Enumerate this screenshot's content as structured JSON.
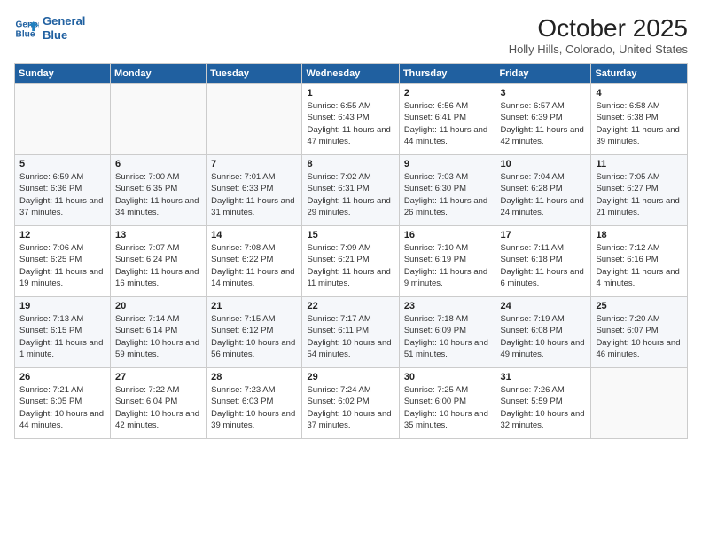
{
  "header": {
    "logo_line1": "General",
    "logo_line2": "Blue",
    "title": "October 2025",
    "subtitle": "Holly Hills, Colorado, United States"
  },
  "days_of_week": [
    "Sunday",
    "Monday",
    "Tuesday",
    "Wednesday",
    "Thursday",
    "Friday",
    "Saturday"
  ],
  "weeks": [
    [
      {
        "day": "",
        "info": ""
      },
      {
        "day": "",
        "info": ""
      },
      {
        "day": "",
        "info": ""
      },
      {
        "day": "1",
        "info": "Sunrise: 6:55 AM\nSunset: 6:43 PM\nDaylight: 11 hours and 47 minutes."
      },
      {
        "day": "2",
        "info": "Sunrise: 6:56 AM\nSunset: 6:41 PM\nDaylight: 11 hours and 44 minutes."
      },
      {
        "day": "3",
        "info": "Sunrise: 6:57 AM\nSunset: 6:39 PM\nDaylight: 11 hours and 42 minutes."
      },
      {
        "day": "4",
        "info": "Sunrise: 6:58 AM\nSunset: 6:38 PM\nDaylight: 11 hours and 39 minutes."
      }
    ],
    [
      {
        "day": "5",
        "info": "Sunrise: 6:59 AM\nSunset: 6:36 PM\nDaylight: 11 hours and 37 minutes."
      },
      {
        "day": "6",
        "info": "Sunrise: 7:00 AM\nSunset: 6:35 PM\nDaylight: 11 hours and 34 minutes."
      },
      {
        "day": "7",
        "info": "Sunrise: 7:01 AM\nSunset: 6:33 PM\nDaylight: 11 hours and 31 minutes."
      },
      {
        "day": "8",
        "info": "Sunrise: 7:02 AM\nSunset: 6:31 PM\nDaylight: 11 hours and 29 minutes."
      },
      {
        "day": "9",
        "info": "Sunrise: 7:03 AM\nSunset: 6:30 PM\nDaylight: 11 hours and 26 minutes."
      },
      {
        "day": "10",
        "info": "Sunrise: 7:04 AM\nSunset: 6:28 PM\nDaylight: 11 hours and 24 minutes."
      },
      {
        "day": "11",
        "info": "Sunrise: 7:05 AM\nSunset: 6:27 PM\nDaylight: 11 hours and 21 minutes."
      }
    ],
    [
      {
        "day": "12",
        "info": "Sunrise: 7:06 AM\nSunset: 6:25 PM\nDaylight: 11 hours and 19 minutes."
      },
      {
        "day": "13",
        "info": "Sunrise: 7:07 AM\nSunset: 6:24 PM\nDaylight: 11 hours and 16 minutes."
      },
      {
        "day": "14",
        "info": "Sunrise: 7:08 AM\nSunset: 6:22 PM\nDaylight: 11 hours and 14 minutes."
      },
      {
        "day": "15",
        "info": "Sunrise: 7:09 AM\nSunset: 6:21 PM\nDaylight: 11 hours and 11 minutes."
      },
      {
        "day": "16",
        "info": "Sunrise: 7:10 AM\nSunset: 6:19 PM\nDaylight: 11 hours and 9 minutes."
      },
      {
        "day": "17",
        "info": "Sunrise: 7:11 AM\nSunset: 6:18 PM\nDaylight: 11 hours and 6 minutes."
      },
      {
        "day": "18",
        "info": "Sunrise: 7:12 AM\nSunset: 6:16 PM\nDaylight: 11 hours and 4 minutes."
      }
    ],
    [
      {
        "day": "19",
        "info": "Sunrise: 7:13 AM\nSunset: 6:15 PM\nDaylight: 11 hours and 1 minute."
      },
      {
        "day": "20",
        "info": "Sunrise: 7:14 AM\nSunset: 6:14 PM\nDaylight: 10 hours and 59 minutes."
      },
      {
        "day": "21",
        "info": "Sunrise: 7:15 AM\nSunset: 6:12 PM\nDaylight: 10 hours and 56 minutes."
      },
      {
        "day": "22",
        "info": "Sunrise: 7:17 AM\nSunset: 6:11 PM\nDaylight: 10 hours and 54 minutes."
      },
      {
        "day": "23",
        "info": "Sunrise: 7:18 AM\nSunset: 6:09 PM\nDaylight: 10 hours and 51 minutes."
      },
      {
        "day": "24",
        "info": "Sunrise: 7:19 AM\nSunset: 6:08 PM\nDaylight: 10 hours and 49 minutes."
      },
      {
        "day": "25",
        "info": "Sunrise: 7:20 AM\nSunset: 6:07 PM\nDaylight: 10 hours and 46 minutes."
      }
    ],
    [
      {
        "day": "26",
        "info": "Sunrise: 7:21 AM\nSunset: 6:05 PM\nDaylight: 10 hours and 44 minutes."
      },
      {
        "day": "27",
        "info": "Sunrise: 7:22 AM\nSunset: 6:04 PM\nDaylight: 10 hours and 42 minutes."
      },
      {
        "day": "28",
        "info": "Sunrise: 7:23 AM\nSunset: 6:03 PM\nDaylight: 10 hours and 39 minutes."
      },
      {
        "day": "29",
        "info": "Sunrise: 7:24 AM\nSunset: 6:02 PM\nDaylight: 10 hours and 37 minutes."
      },
      {
        "day": "30",
        "info": "Sunrise: 7:25 AM\nSunset: 6:00 PM\nDaylight: 10 hours and 35 minutes."
      },
      {
        "day": "31",
        "info": "Sunrise: 7:26 AM\nSunset: 5:59 PM\nDaylight: 10 hours and 32 minutes."
      },
      {
        "day": "",
        "info": ""
      }
    ]
  ]
}
